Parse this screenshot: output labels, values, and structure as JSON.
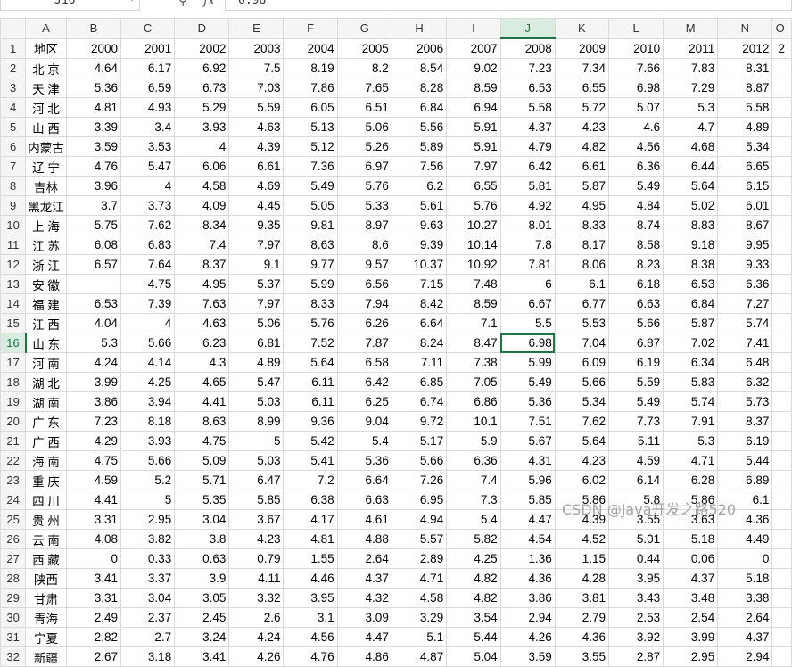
{
  "formula_bar": {
    "cell_ref": "J16",
    "zoom_icon": "magnifier-icon",
    "fx_label": "fx",
    "value": "6.98"
  },
  "columns": [
    "A",
    "B",
    "C",
    "D",
    "E",
    "F",
    "G",
    "H",
    "I",
    "J",
    "K",
    "L",
    "M",
    "N",
    "O"
  ],
  "active_column": "J",
  "active_row": 16,
  "header_row": [
    "地区",
    "2000",
    "2001",
    "2002",
    "2003",
    "2004",
    "2005",
    "2006",
    "2007",
    "2008",
    "2009",
    "2010",
    "2011",
    "2012",
    "2"
  ],
  "rows": [
    [
      "北 京",
      "4.64",
      "6.17",
      "6.92",
      "7.5",
      "8.19",
      "8.2",
      "8.54",
      "9.02",
      "7.23",
      "7.34",
      "7.66",
      "7.83",
      "8.31",
      ""
    ],
    [
      "天 津",
      "5.36",
      "6.59",
      "6.73",
      "7.03",
      "7.86",
      "7.65",
      "8.28",
      "8.59",
      "6.53",
      "6.55",
      "6.98",
      "7.29",
      "8.87",
      ""
    ],
    [
      "河 北",
      "4.81",
      "4.93",
      "5.29",
      "5.59",
      "6.05",
      "6.51",
      "6.84",
      "6.94",
      "5.58",
      "5.72",
      "5.07",
      "5.3",
      "5.58",
      ""
    ],
    [
      "山 西",
      "3.39",
      "3.4",
      "3.93",
      "4.63",
      "5.13",
      "5.06",
      "5.56",
      "5.91",
      "4.37",
      "4.23",
      "4.6",
      "4.7",
      "4.89",
      ""
    ],
    [
      "内蒙古",
      "3.59",
      "3.53",
      "4",
      "4.39",
      "5.12",
      "5.26",
      "5.89",
      "5.91",
      "4.79",
      "4.82",
      "4.56",
      "4.68",
      "5.34",
      ""
    ],
    [
      "辽 宁",
      "4.76",
      "5.47",
      "6.06",
      "6.61",
      "7.36",
      "6.97",
      "7.56",
      "7.97",
      "6.42",
      "6.61",
      "6.36",
      "6.44",
      "6.65",
      ""
    ],
    [
      "吉林",
      "3.96",
      "4",
      "4.58",
      "4.69",
      "5.49",
      "5.76",
      "6.2",
      "6.55",
      "5.81",
      "5.87",
      "5.49",
      "5.64",
      "6.15",
      ""
    ],
    [
      "黑龙江",
      "3.7",
      "3.73",
      "4.09",
      "4.45",
      "5.05",
      "5.33",
      "5.61",
      "5.76",
      "4.92",
      "4.95",
      "4.84",
      "5.02",
      "6.01",
      ""
    ],
    [
      "上 海",
      "5.75",
      "7.62",
      "8.34",
      "9.35",
      "9.81",
      "8.97",
      "9.63",
      "10.27",
      "8.01",
      "8.33",
      "8.74",
      "8.83",
      "8.67",
      ""
    ],
    [
      "江 苏",
      "6.08",
      "6.83",
      "7.4",
      "7.97",
      "8.63",
      "8.6",
      "9.39",
      "10.14",
      "7.8",
      "8.17",
      "8.58",
      "9.18",
      "9.95",
      ""
    ],
    [
      "浙 江",
      "6.57",
      "7.64",
      "8.37",
      "9.1",
      "9.77",
      "9.57",
      "10.37",
      "10.92",
      "7.81",
      "8.06",
      "8.23",
      "8.38",
      "9.33",
      ""
    ],
    [
      "安 徽",
      "",
      "4.75",
      "4.95",
      "5.37",
      "5.99",
      "6.56",
      "7.15",
      "7.48",
      "6",
      "6.1",
      "6.18",
      "6.53",
      "6.36",
      ""
    ],
    [
      "福 建",
      "6.53",
      "7.39",
      "7.63",
      "7.97",
      "8.33",
      "7.94",
      "8.42",
      "8.59",
      "6.67",
      "6.77",
      "6.63",
      "6.84",
      "7.27",
      ""
    ],
    [
      "江 西",
      "4.04",
      "4",
      "4.63",
      "5.06",
      "5.76",
      "6.26",
      "6.64",
      "7.1",
      "5.5",
      "5.53",
      "5.66",
      "5.87",
      "5.74",
      ""
    ],
    [
      "山 东",
      "5.3",
      "5.66",
      "6.23",
      "6.81",
      "7.52",
      "7.87",
      "8.24",
      "8.47",
      "6.98",
      "7.04",
      "6.87",
      "7.02",
      "7.41",
      ""
    ],
    [
      "河 南",
      "4.24",
      "4.14",
      "4.3",
      "4.89",
      "5.64",
      "6.58",
      "7.11",
      "7.38",
      "5.99",
      "6.09",
      "6.19",
      "6.34",
      "6.48",
      ""
    ],
    [
      "湖 北",
      "3.99",
      "4.25",
      "4.65",
      "5.47",
      "6.11",
      "6.42",
      "6.85",
      "7.05",
      "5.49",
      "5.66",
      "5.59",
      "5.83",
      "6.32",
      ""
    ],
    [
      "湖 南",
      "3.86",
      "3.94",
      "4.41",
      "5.03",
      "6.11",
      "6.25",
      "6.74",
      "6.86",
      "5.36",
      "5.34",
      "5.49",
      "5.74",
      "5.73",
      ""
    ],
    [
      "广 东",
      "7.23",
      "8.18",
      "8.63",
      "8.99",
      "9.36",
      "9.04",
      "9.72",
      "10.1",
      "7.51",
      "7.62",
      "7.73",
      "7.91",
      "8.37",
      ""
    ],
    [
      "广 西",
      "4.29",
      "3.93",
      "4.75",
      "5",
      "5.42",
      "5.4",
      "5.17",
      "5.9",
      "5.67",
      "5.64",
      "5.11",
      "5.3",
      "6.19",
      ""
    ],
    [
      "海 南",
      "4.75",
      "5.66",
      "5.09",
      "5.03",
      "5.41",
      "5.36",
      "5.66",
      "6.36",
      "4.31",
      "4.23",
      "4.59",
      "4.71",
      "5.44",
      ""
    ],
    [
      "重 庆",
      "4.59",
      "5.2",
      "5.71",
      "6.47",
      "7.2",
      "6.64",
      "7.26",
      "7.4",
      "5.96",
      "6.02",
      "6.14",
      "6.28",
      "6.89",
      ""
    ],
    [
      "四 川",
      "4.41",
      "5",
      "5.35",
      "5.85",
      "6.38",
      "6.63",
      "6.95",
      "7.3",
      "5.85",
      "5.86",
      "5.8",
      "5.86",
      "6.1",
      ""
    ],
    [
      "贵 州",
      "3.31",
      "2.95",
      "3.04",
      "3.67",
      "4.17",
      "4.61",
      "4.94",
      "5.4",
      "4.47",
      "4.39",
      "3.55",
      "3.63",
      "4.36",
      ""
    ],
    [
      "云 南",
      "4.08",
      "3.82",
      "3.8",
      "4.23",
      "4.81",
      "4.88",
      "5.57",
      "5.82",
      "4.54",
      "4.52",
      "5.01",
      "5.18",
      "4.49",
      ""
    ],
    [
      "西 藏",
      "0",
      "0.33",
      "0.63",
      "0.79",
      "1.55",
      "2.64",
      "2.89",
      "4.25",
      "1.36",
      "1.15",
      "0.44",
      "0.06",
      "0",
      ""
    ],
    [
      "陕西",
      "3.41",
      "3.37",
      "3.9",
      "4.11",
      "4.46",
      "4.37",
      "4.71",
      "4.82",
      "4.36",
      "4.28",
      "3.95",
      "4.37",
      "5.18",
      ""
    ],
    [
      "甘肃",
      "3.31",
      "3.04",
      "3.05",
      "3.32",
      "3.95",
      "4.32",
      "4.58",
      "4.82",
      "3.86",
      "3.81",
      "3.43",
      "3.48",
      "3.38",
      ""
    ],
    [
      "青海",
      "2.49",
      "2.37",
      "2.45",
      "2.6",
      "3.1",
      "3.09",
      "3.29",
      "3.54",
      "2.94",
      "2.79",
      "2.53",
      "2.54",
      "2.64",
      ""
    ],
    [
      "宁夏",
      "2.82",
      "2.7",
      "3.24",
      "4.24",
      "4.56",
      "4.47",
      "5.1",
      "5.44",
      "4.26",
      "4.36",
      "3.92",
      "3.99",
      "4.37",
      ""
    ],
    [
      "新疆",
      "2.67",
      "3.18",
      "3.41",
      "4.26",
      "4.76",
      "4.86",
      "4.87",
      "5.04",
      "3.59",
      "3.55",
      "2.87",
      "2.95",
      "2.94",
      ""
    ]
  ],
  "watermark": "CSDN @Java开发之路520"
}
